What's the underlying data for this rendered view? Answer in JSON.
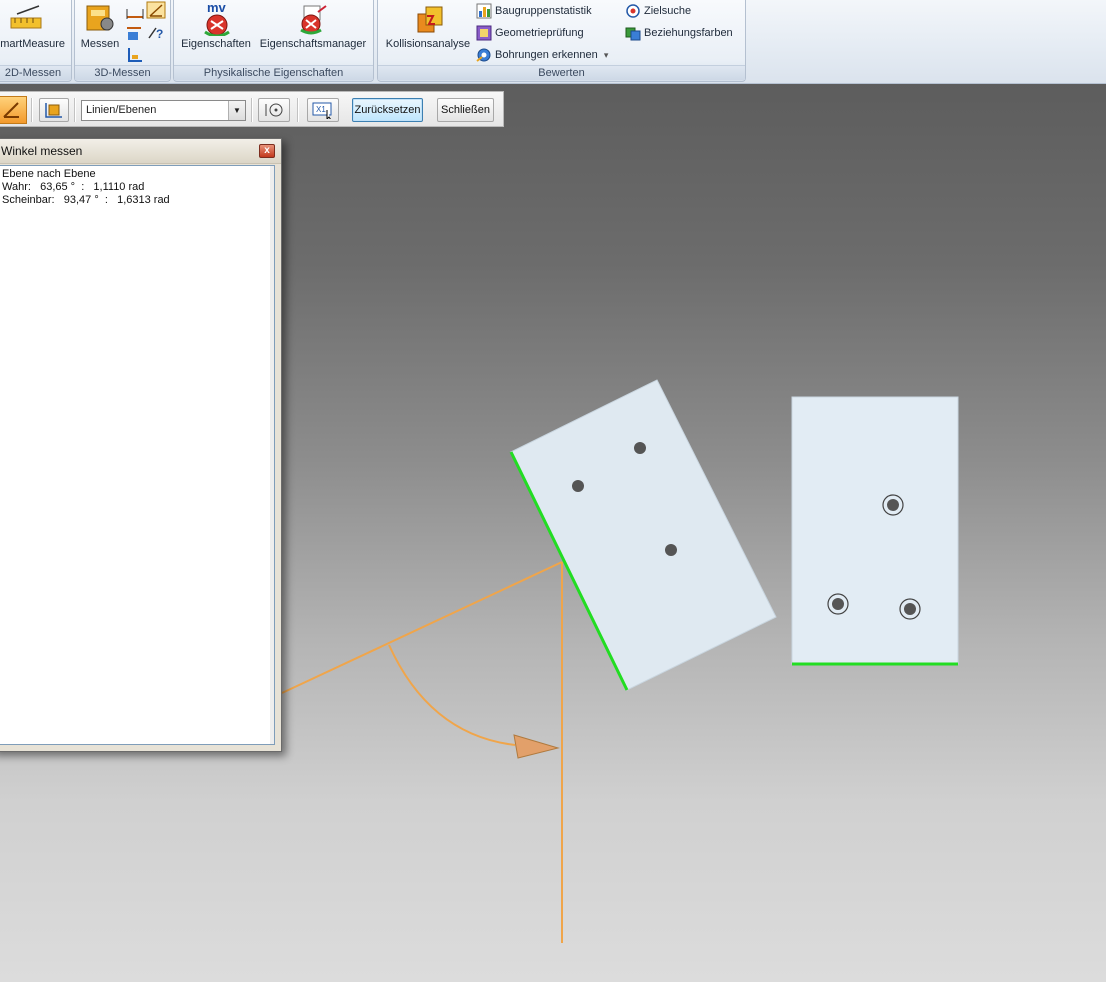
{
  "ribbon": {
    "groups": {
      "g2d": "2D-Messen",
      "g3d": "3D-Messen",
      "phys": "Physikalische Eigenschaften",
      "bewerten": "Bewerten"
    },
    "buttons": {
      "smartmeasure": "martMeasure",
      "messen": "Messen",
      "eigenschaften": "Eigenschaften",
      "eigenschaftsmanager": "Eigenschaftsmanager",
      "kollision": "Kollisionsanalyse",
      "baugruppe": "Baugruppenstatistik",
      "geometrie": "Geometrieprüfung",
      "bohrungen": "Bohrungen erkennen",
      "bohrungen_arrow": "▾",
      "zielsuche": "Zielsuche",
      "beziehung": "Beziehungsfarben",
      "mv_badge": "mv"
    }
  },
  "commandbar": {
    "combo_value": "Linien/Ebenen",
    "combo_arrow": "▼",
    "reset": "Zurücksetzen",
    "close": "Schließen"
  },
  "dialog": {
    "title": "Winkel messen",
    "close_glyph": "x",
    "lines": {
      "l1": "Ebene nach Ebene",
      "l2": "Wahr:   63,65 °  :   1,1110 rad",
      "l3": "Scheinbar:   93,47 °  :   1,6313 rad"
    }
  },
  "colors": {
    "plate_fill": "#dde8f0",
    "edge_highlight": "#22dd22",
    "measure_line": "#f0a54a"
  }
}
